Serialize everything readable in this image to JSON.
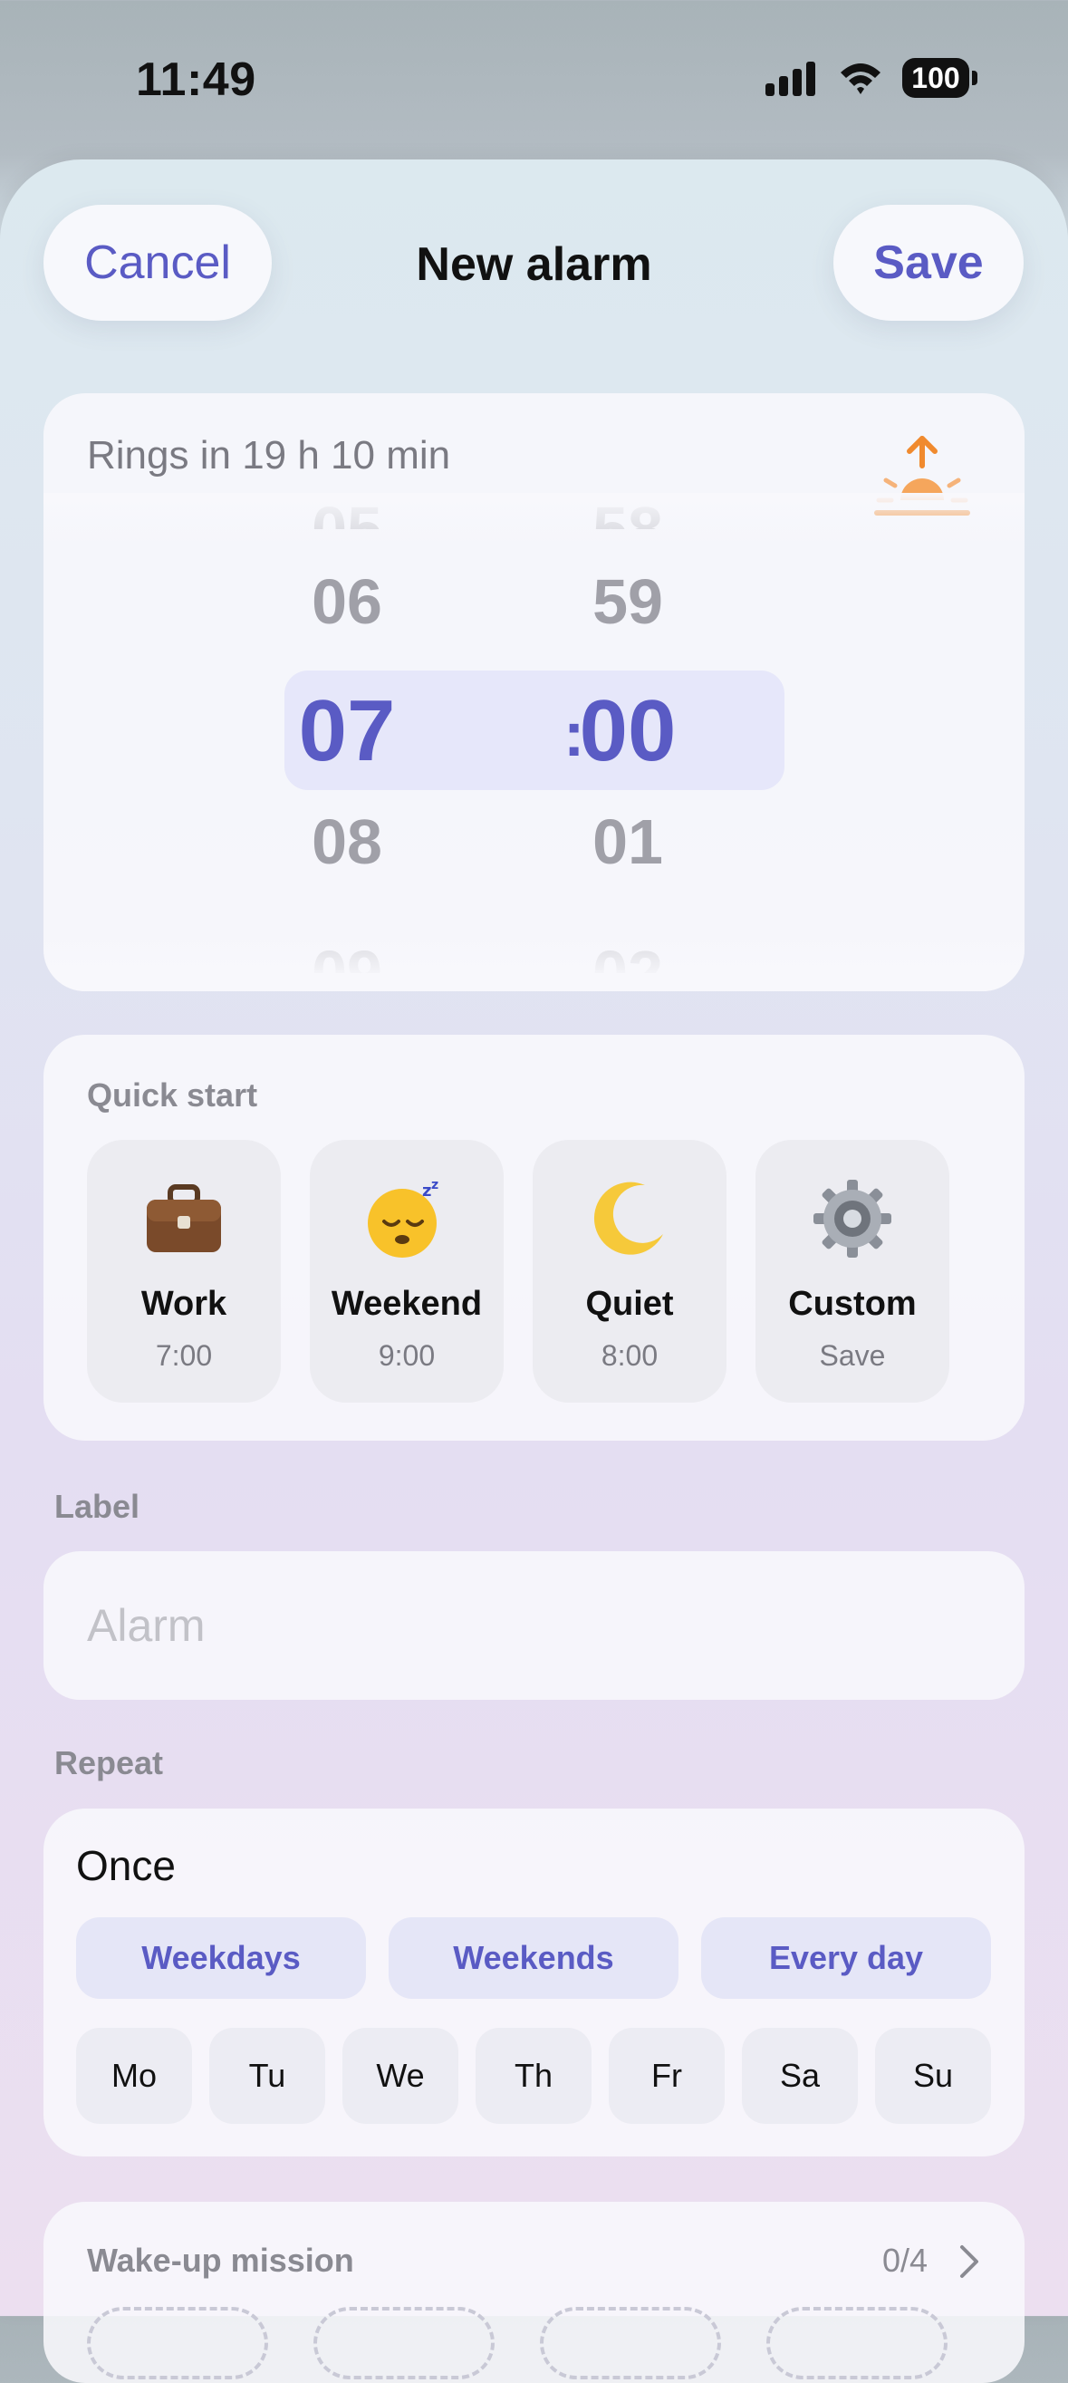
{
  "status_bar": {
    "time": "11:49",
    "battery": "100"
  },
  "header": {
    "cancel_label": "Cancel",
    "title": "New alarm",
    "save_label": "Save"
  },
  "time_picker": {
    "rings_in": "Rings in 19 h 10 min",
    "hours": {
      "above2": "05",
      "above": "06",
      "selected": "07",
      "below": "08",
      "below2": "09"
    },
    "separator": ":",
    "minutes": {
      "above2": "58",
      "above": "59",
      "selected": "00",
      "below": "01",
      "below2": "02"
    }
  },
  "quick_start": {
    "label": "Quick start",
    "tiles": [
      {
        "icon": "briefcase-icon",
        "name": "Work",
        "sub": "7:00"
      },
      {
        "icon": "sleeping-face-icon",
        "name": "Weekend",
        "sub": "9:00"
      },
      {
        "icon": "crescent-moon-icon",
        "name": "Quiet",
        "sub": "8:00"
      },
      {
        "icon": "gear-icon",
        "name": "Custom",
        "sub": "Save"
      }
    ]
  },
  "label_section": {
    "heading": "Label",
    "placeholder": "Alarm"
  },
  "repeat": {
    "heading": "Repeat",
    "value": "Once",
    "presets": [
      "Weekdays",
      "Weekends",
      "Every day"
    ],
    "days": [
      "Mo",
      "Tu",
      "We",
      "Th",
      "Fr",
      "Sa",
      "Su"
    ]
  },
  "wake_mission": {
    "title": "Wake-up mission",
    "count": "0/4"
  },
  "colors": {
    "accent": "#5a5bc4",
    "sunrise": "#f08a2e"
  }
}
